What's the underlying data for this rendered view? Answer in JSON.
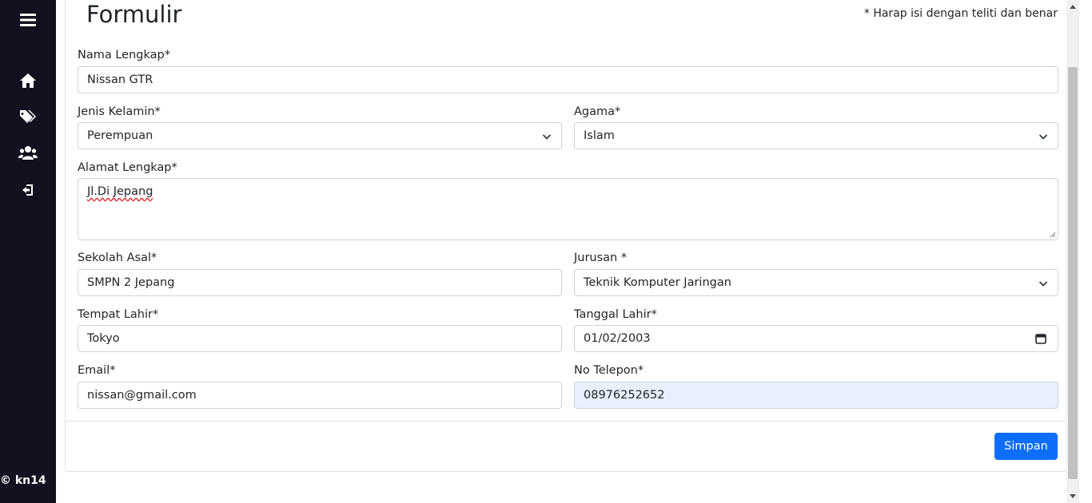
{
  "sidebar": {
    "items": [
      {
        "icon": "hamburger-menu-icon"
      },
      {
        "icon": "home-icon"
      },
      {
        "icon": "tags-icon"
      },
      {
        "icon": "users-icon"
      },
      {
        "icon": "sign-out-icon"
      }
    ],
    "copyright": "© kn14"
  },
  "form": {
    "title": "Formulir",
    "note": "* Harap isi dengan teliti dan benar",
    "nama": {
      "label": "Nama Lengkap*",
      "value": "Nissan GTR"
    },
    "jenis_kelamin": {
      "label": "Jenis Kelamin*",
      "value": "Perempuan"
    },
    "agama": {
      "label": "Agama*",
      "value": "Islam"
    },
    "alamat": {
      "label": "Alamat Lengkap*",
      "value": "Jl.Di Jepang"
    },
    "sekolah": {
      "label": "Sekolah Asal*",
      "value": "SMPN 2 Jepang"
    },
    "jurusan": {
      "label": "Jurusan *",
      "value": "Teknik Komputer Jaringan"
    },
    "tempat_lahir": {
      "label": "Tempat Lahir*",
      "value": "Tokyo"
    },
    "tanggal_lahir": {
      "label": "Tanggal Lahir*",
      "value": "01/02/2003"
    },
    "email": {
      "label": "Email*",
      "value": "nissan@gmail.com"
    },
    "telepon": {
      "label": "No Telepon*",
      "value": "08976252652"
    },
    "save_label": "Simpan"
  },
  "colors": {
    "sidebar_bg": "#13111f",
    "primary": "#0d6efd",
    "autofill_bg": "#e8f0fe"
  }
}
